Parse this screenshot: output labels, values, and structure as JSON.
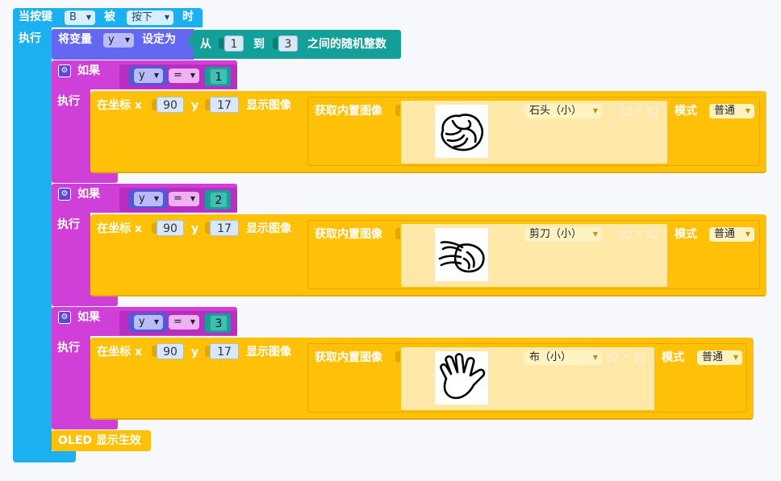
{
  "event": {
    "prefix": "当按键",
    "button_value": "B",
    "mid": "被",
    "action_value": "按下",
    "suffix": "时",
    "exec_label": "执行"
  },
  "assign": {
    "prefix": "将变量",
    "variable": "y",
    "set_to": "设定为",
    "from": "从",
    "from_value": "1",
    "to": "到",
    "to_value": "3",
    "random_suffix": "之间的随机整数"
  },
  "ifs": [
    {
      "if_label": "如果",
      "variable": "y",
      "operator": "=",
      "compare_value": "1",
      "exec_label": "执行",
      "pos_label": "在坐标 x",
      "x_value": "90",
      "y_label": "y",
      "y_value": "17",
      "show_label": "显示图像",
      "get_label": "获取内置图像",
      "image_name": "石头（小）",
      "size": "32 * 32",
      "mode_label": "模式",
      "mode_value": "普通",
      "icon": "fist-icon"
    },
    {
      "if_label": "如果",
      "variable": "y",
      "operator": "=",
      "compare_value": "2",
      "exec_label": "执行",
      "pos_label": "在坐标 x",
      "x_value": "90",
      "y_label": "y",
      "y_value": "17",
      "show_label": "显示图像",
      "get_label": "获取内置图像",
      "image_name": "剪刀（小）",
      "size": "32 * 32",
      "mode_label": "模式",
      "mode_value": "普通",
      "icon": "scissors-hand-icon"
    },
    {
      "if_label": "如果",
      "variable": "y",
      "operator": "=",
      "compare_value": "3",
      "exec_label": "执行",
      "pos_label": "在坐标 x",
      "x_value": "90",
      "y_label": "y",
      "y_value": "17",
      "show_label": "显示图像",
      "get_label": "获取内置图像",
      "image_name": "布（小）",
      "size": "32 * 32",
      "mode_label": "模式",
      "mode_value": "普通",
      "icon": "open-hand-icon"
    }
  ],
  "oled_refresh": "OLED 显示生效",
  "colors": {
    "event": "#1db0f0",
    "variable": "#6468f0",
    "variable_dark": "#5258d8",
    "math": "#14a09a",
    "logic": "#d040d8",
    "logic_dark": "#b82ec0",
    "display": "#ffc107",
    "display_dark": "#e3a800",
    "image_panel": "#ffe8a8"
  }
}
